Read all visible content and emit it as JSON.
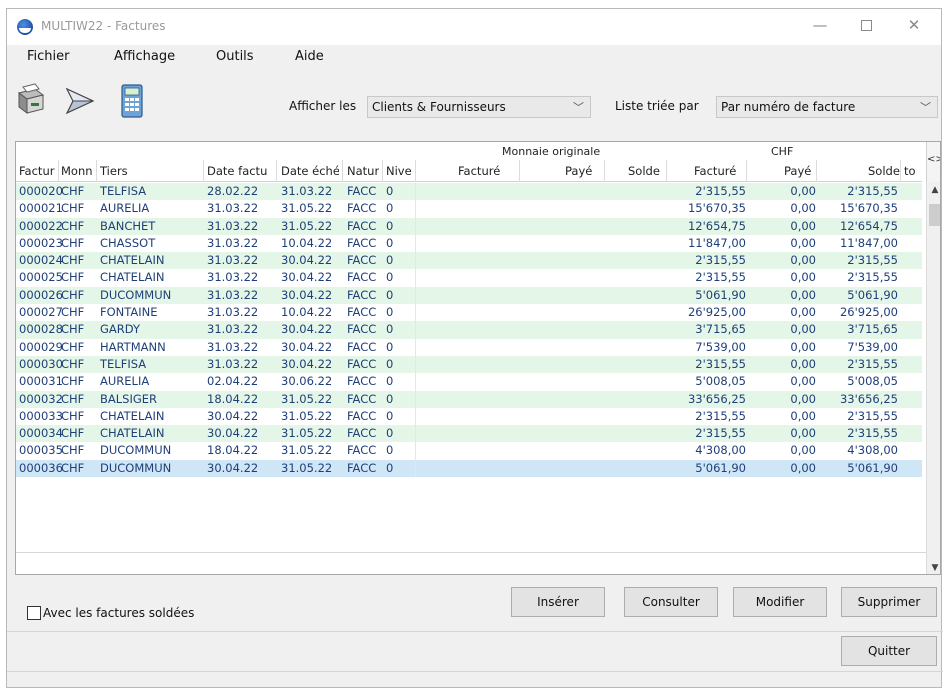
{
  "window": {
    "title": "MULTIW22 - Factures"
  },
  "menu": {
    "items": [
      "Fichier",
      "Affichage",
      "Outils",
      "Aide"
    ]
  },
  "toolbar": {
    "icons": [
      "printer-icon",
      "sender-icon",
      "calculator-icon"
    ],
    "afficher_label": "Afficher les",
    "afficher_value": "Clients & Fournisseurs",
    "trie_label": "Liste triée par",
    "trie_value": "Par numéro de facture"
  },
  "grid": {
    "group_orig": "Monnaie originale",
    "group_chf": "CHF",
    "columns": [
      "Factur",
      "Monn",
      "Tiers",
      "Date factu",
      "Date éché",
      "Natur",
      "Nive",
      "Facturé",
      "Payé",
      "Solde",
      "Facturé",
      "Payé",
      "Solde",
      "to"
    ],
    "corner": "<>",
    "rows": [
      [
        "000020",
        "CHF",
        "TELFISA",
        "28.02.22",
        "31.03.22",
        "FACC",
        "0",
        "2'315,55",
        "0,00",
        "2'315,55"
      ],
      [
        "000021",
        "CHF",
        "AURELIA",
        "31.03.22",
        "31.05.22",
        "FACC",
        "0",
        "15'670,35",
        "0,00",
        "15'670,35"
      ],
      [
        "000022",
        "CHF",
        "BANCHET",
        "31.03.22",
        "31.05.22",
        "FACC",
        "0",
        "12'654,75",
        "0,00",
        "12'654,75"
      ],
      [
        "000023",
        "CHF",
        "CHASSOT",
        "31.03.22",
        "10.04.22",
        "FACC",
        "0",
        "11'847,00",
        "0,00",
        "11'847,00"
      ],
      [
        "000024",
        "CHF",
        "CHATELAIN",
        "31.03.22",
        "30.04.22",
        "FACC",
        "0",
        "2'315,55",
        "0,00",
        "2'315,55"
      ],
      [
        "000025",
        "CHF",
        "CHATELAIN",
        "31.03.22",
        "30.04.22",
        "FACC",
        "0",
        "2'315,55",
        "0,00",
        "2'315,55"
      ],
      [
        "000026",
        "CHF",
        "DUCOMMUN",
        "31.03.22",
        "30.04.22",
        "FACC",
        "0",
        "5'061,90",
        "0,00",
        "5'061,90"
      ],
      [
        "000027",
        "CHF",
        "FONTAINE",
        "31.03.22",
        "10.04.22",
        "FACC",
        "0",
        "26'925,00",
        "0,00",
        "26'925,00"
      ],
      [
        "000028",
        "CHF",
        "GARDY",
        "31.03.22",
        "30.04.22",
        "FACC",
        "0",
        "3'715,65",
        "0,00",
        "3'715,65"
      ],
      [
        "000029",
        "CHF",
        "HARTMANN",
        "31.03.22",
        "30.04.22",
        "FACC",
        "0",
        "7'539,00",
        "0,00",
        "7'539,00"
      ],
      [
        "000030",
        "CHF",
        "TELFISA",
        "31.03.22",
        "30.04.22",
        "FACC",
        "0",
        "2'315,55",
        "0,00",
        "2'315,55"
      ],
      [
        "000031",
        "CHF",
        "AURELIA",
        "02.04.22",
        "30.06.22",
        "FACC",
        "0",
        "5'008,05",
        "0,00",
        "5'008,05"
      ],
      [
        "000032",
        "CHF",
        "BALSIGER",
        "18.04.22",
        "31.05.22",
        "FACC",
        "0",
        "33'656,25",
        "0,00",
        "33'656,25"
      ],
      [
        "000033",
        "CHF",
        "CHATELAIN",
        "30.04.22",
        "31.05.22",
        "FACC",
        "0",
        "2'315,55",
        "0,00",
        "2'315,55"
      ],
      [
        "000034",
        "CHF",
        "CHATELAIN",
        "30.04.22",
        "31.05.22",
        "FACC",
        "0",
        "2'315,55",
        "0,00",
        "2'315,55"
      ],
      [
        "000035",
        "CHF",
        "DUCOMMUN",
        "18.04.22",
        "31.05.22",
        "FACC",
        "0",
        "4'308,00",
        "0,00",
        "4'308,00"
      ],
      [
        "000036",
        "CHF",
        "DUCOMMUN",
        "30.04.22",
        "31.05.22",
        "FACC",
        "0",
        "5'061,90",
        "0,00",
        "5'061,90"
      ]
    ],
    "selected_index": 16
  },
  "bottom": {
    "checkbox_label": "Avec les factures soldées",
    "checkbox_checked": false,
    "buttons": [
      "Insérer",
      "Consulter",
      "Modifier",
      "Supprimer"
    ],
    "quit": "Quitter"
  }
}
